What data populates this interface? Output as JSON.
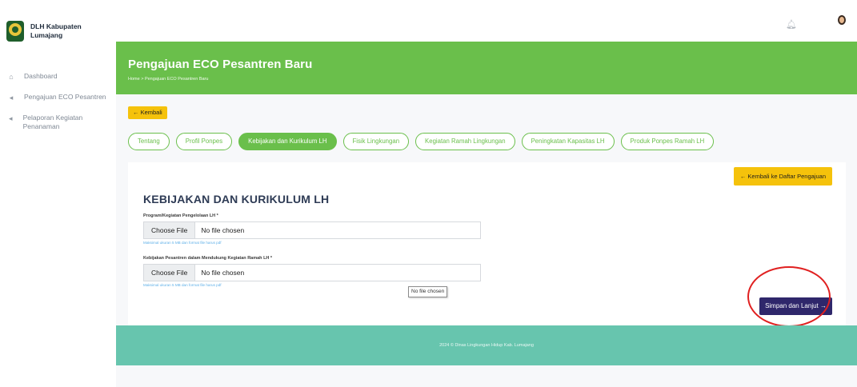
{
  "brand": {
    "name": "DLH Kabupaten Lumajang"
  },
  "sidebar": {
    "items": [
      {
        "label": "Dashboard",
        "icon": "home-icon"
      },
      {
        "label": "Pengajuan ECO Pesantren",
        "icon": "send-icon"
      },
      {
        "label": "Pelaporan Kegiatan Penanaman",
        "icon": "send-icon"
      }
    ]
  },
  "header": {
    "title": "Pengajuan ECO Pesantren Baru",
    "breadcrumb": "Home  >  Pengajuan ECO Pesantren Baru"
  },
  "actions": {
    "back": "← Kembali",
    "back_to_list": "← Kembali ke Daftar Pengajuan",
    "submit": "Simpan dan Lanjut →"
  },
  "tabs": [
    {
      "label": "Tentang",
      "active": false
    },
    {
      "label": "Profil Ponpes",
      "active": false
    },
    {
      "label": "Kebijakan dan Kurikulum LH",
      "active": true
    },
    {
      "label": "Fisik Lingkungan",
      "active": false
    },
    {
      "label": "Kegiatan Ramah Lingkungan",
      "active": false
    },
    {
      "label": "Peningkatan Kapasitas LH",
      "active": false
    },
    {
      "label": "Produk Ponpes Ramah LH",
      "active": false
    }
  ],
  "form": {
    "title": "KEBIJAKAN DAN KURIKULUM LH",
    "fields": [
      {
        "label": "Program/Kegiatan Pengelolaan LH *",
        "button": "Choose File",
        "status": "No file chosen",
        "hint": "Maksimal ukuran 5 MB dan format file harus pdf"
      },
      {
        "label": "Kebijakan Pesantren dalam Mendukung Kegiatan Ramah LH *",
        "button": "Choose File",
        "status": "No file chosen",
        "hint": "Maksimal ukuran 5 MB dan format file harus pdf"
      }
    ],
    "tooltip": "No file chosen"
  },
  "footer": {
    "text": "2024 © Dinas Lingkungan Hidup Kab. Lumajang"
  },
  "colors": {
    "primary_green": "#6abf4b",
    "accent_yellow": "#f5c20b",
    "submit_navy": "#2f276b",
    "footer_teal": "#67c5ae",
    "highlight_red": "#e02020"
  }
}
